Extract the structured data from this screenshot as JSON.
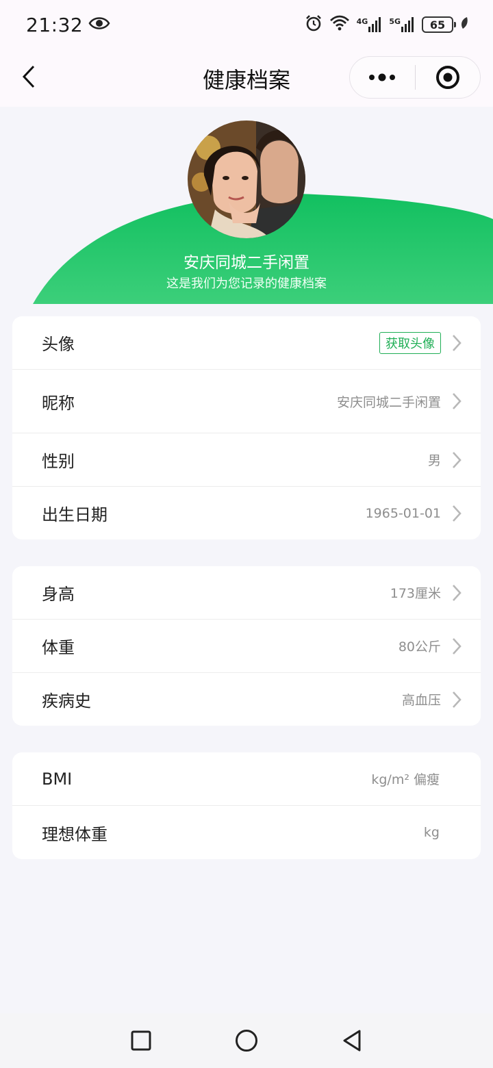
{
  "status_bar": {
    "time": "21:32",
    "network_4g": "4G",
    "network_5g": "5G",
    "battery": "65"
  },
  "nav": {
    "title": "健康档案",
    "back_icon": "chevron-left-icon",
    "more_icon": "more-dots-icon",
    "target_icon": "target-circle-icon"
  },
  "banner": {
    "name": "安庆同城二手闲置",
    "subtitle": "这是我们为您记录的健康档案",
    "accent_color": "#22c064"
  },
  "profile_card": {
    "rows": [
      {
        "label": "头像",
        "tag": "获取头像"
      },
      {
        "label": "昵称",
        "value": "安庆同城二手闲置"
      },
      {
        "label": "性别",
        "value": "男"
      },
      {
        "label": "出生日期",
        "value": "1965-01-01"
      }
    ]
  },
  "body_card": {
    "rows": [
      {
        "label": "身高",
        "value": "173厘米"
      },
      {
        "label": "体重",
        "value": "80公斤"
      },
      {
        "label": "疾病史",
        "value": "高血压"
      }
    ]
  },
  "bmi_card": {
    "rows": [
      {
        "label": "BMI",
        "value": "kg/m² 偏瘦"
      },
      {
        "label": "理想体重",
        "value": "kg"
      }
    ]
  },
  "system_nav": {
    "recent_icon": "square-icon",
    "home_icon": "circle-icon",
    "back_icon": "triangle-back-icon"
  }
}
